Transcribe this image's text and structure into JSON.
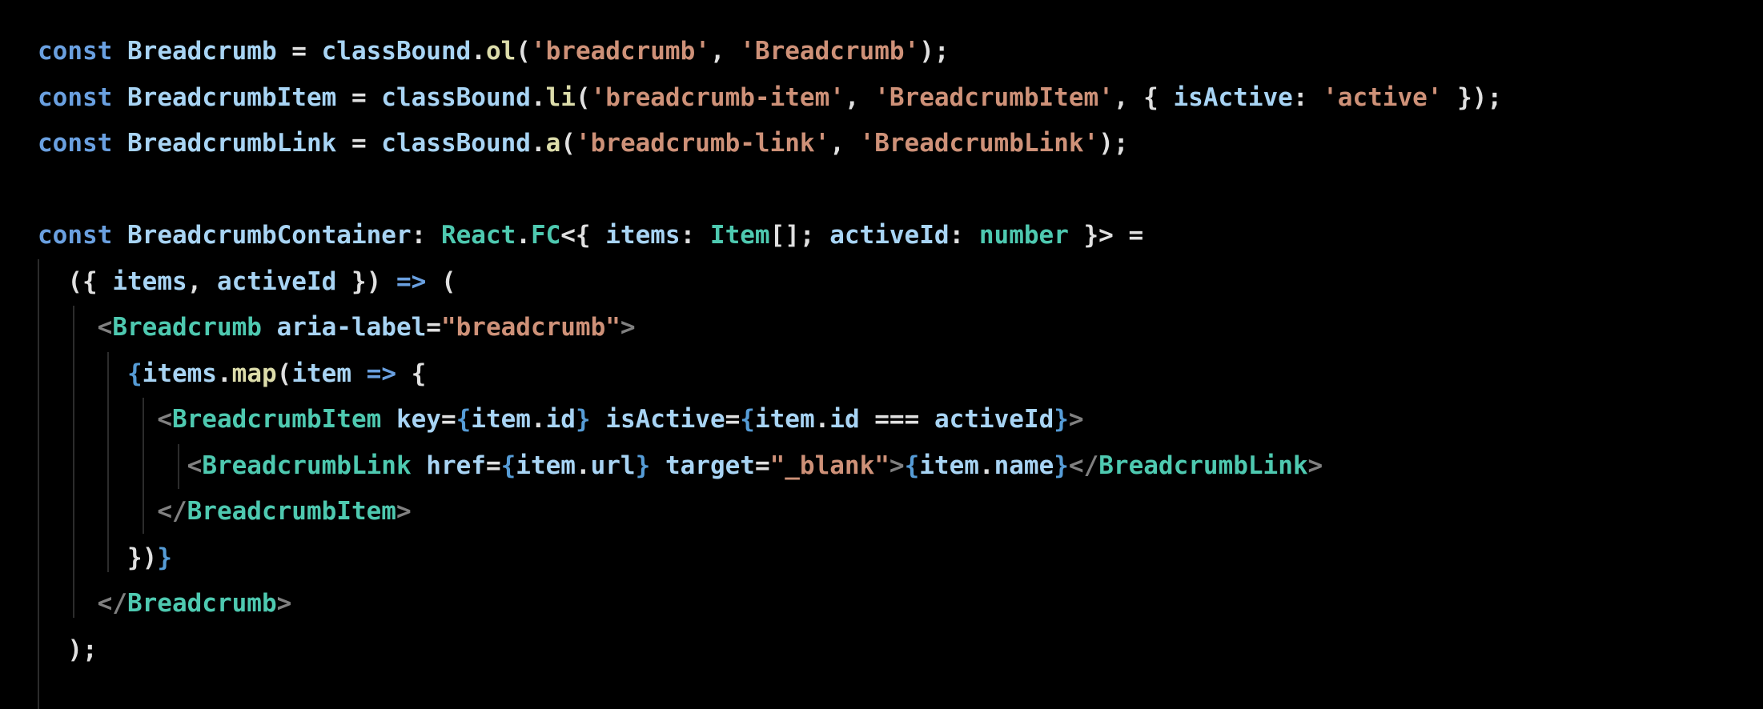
{
  "editor": {
    "lines": [
      [
        {
          "t": "const",
          "c": "kw"
        },
        {
          "t": " ",
          "c": "punc"
        },
        {
          "t": "Breadcrumb",
          "c": "var"
        },
        {
          "t": " = ",
          "c": "punc"
        },
        {
          "t": "classBound",
          "c": "var"
        },
        {
          "t": ".",
          "c": "punc"
        },
        {
          "t": "ol",
          "c": "fn"
        },
        {
          "t": "(",
          "c": "punc"
        },
        {
          "t": "'breadcrumb'",
          "c": "str"
        },
        {
          "t": ", ",
          "c": "punc"
        },
        {
          "t": "'Breadcrumb'",
          "c": "str"
        },
        {
          "t": ");",
          "c": "punc"
        }
      ],
      [
        {
          "t": "const",
          "c": "kw"
        },
        {
          "t": " ",
          "c": "punc"
        },
        {
          "t": "BreadcrumbItem",
          "c": "var"
        },
        {
          "t": " = ",
          "c": "punc"
        },
        {
          "t": "classBound",
          "c": "var"
        },
        {
          "t": ".",
          "c": "punc"
        },
        {
          "t": "li",
          "c": "fn"
        },
        {
          "t": "(",
          "c": "punc"
        },
        {
          "t": "'breadcrumb-item'",
          "c": "str"
        },
        {
          "t": ", ",
          "c": "punc"
        },
        {
          "t": "'BreadcrumbItem'",
          "c": "str"
        },
        {
          "t": ", { ",
          "c": "punc"
        },
        {
          "t": "isActive",
          "c": "var"
        },
        {
          "t": ": ",
          "c": "punc"
        },
        {
          "t": "'active'",
          "c": "str"
        },
        {
          "t": " });",
          "c": "punc"
        }
      ],
      [
        {
          "t": "const",
          "c": "kw"
        },
        {
          "t": " ",
          "c": "punc"
        },
        {
          "t": "BreadcrumbLink",
          "c": "var"
        },
        {
          "t": " = ",
          "c": "punc"
        },
        {
          "t": "classBound",
          "c": "var"
        },
        {
          "t": ".",
          "c": "punc"
        },
        {
          "t": "a",
          "c": "fn"
        },
        {
          "t": "(",
          "c": "punc"
        },
        {
          "t": "'breadcrumb-link'",
          "c": "str"
        },
        {
          "t": ", ",
          "c": "punc"
        },
        {
          "t": "'BreadcrumbLink'",
          "c": "str"
        },
        {
          "t": ");",
          "c": "punc"
        }
      ],
      [],
      [
        {
          "t": "const",
          "c": "kw"
        },
        {
          "t": " ",
          "c": "punc"
        },
        {
          "t": "BreadcrumbContainer",
          "c": "var"
        },
        {
          "t": ": ",
          "c": "punc"
        },
        {
          "t": "React",
          "c": "type"
        },
        {
          "t": ".",
          "c": "punc"
        },
        {
          "t": "FC",
          "c": "type"
        },
        {
          "t": "<{ ",
          "c": "punc"
        },
        {
          "t": "items",
          "c": "var"
        },
        {
          "t": ": ",
          "c": "punc"
        },
        {
          "t": "Item",
          "c": "type"
        },
        {
          "t": "[]; ",
          "c": "punc"
        },
        {
          "t": "activeId",
          "c": "var"
        },
        {
          "t": ": ",
          "c": "punc"
        },
        {
          "t": "number",
          "c": "type"
        },
        {
          "t": " }> =",
          "c": "punc"
        }
      ],
      [
        {
          "t": "  ({ ",
          "c": "punc"
        },
        {
          "t": "items",
          "c": "var"
        },
        {
          "t": ", ",
          "c": "punc"
        },
        {
          "t": "activeId",
          "c": "var"
        },
        {
          "t": " }) ",
          "c": "punc"
        },
        {
          "t": "=>",
          "c": "kw"
        },
        {
          "t": " (",
          "c": "punc"
        }
      ],
      [
        {
          "t": "    ",
          "c": "punc"
        },
        {
          "t": "<",
          "c": "ang"
        },
        {
          "t": "Breadcrumb",
          "c": "tag"
        },
        {
          "t": " ",
          "c": "punc"
        },
        {
          "t": "aria-label",
          "c": "var"
        },
        {
          "t": "=",
          "c": "punc"
        },
        {
          "t": "\"breadcrumb\"",
          "c": "str"
        },
        {
          "t": ">",
          "c": "ang"
        }
      ],
      [
        {
          "t": "      ",
          "c": "punc"
        },
        {
          "t": "{",
          "c": "br"
        },
        {
          "t": "items",
          "c": "var"
        },
        {
          "t": ".",
          "c": "punc"
        },
        {
          "t": "map",
          "c": "fn"
        },
        {
          "t": "(",
          "c": "punc"
        },
        {
          "t": "item",
          "c": "var"
        },
        {
          "t": " ",
          "c": "punc"
        },
        {
          "t": "=>",
          "c": "kw"
        },
        {
          "t": " {",
          "c": "punc"
        }
      ],
      [
        {
          "t": "        ",
          "c": "punc"
        },
        {
          "t": "<",
          "c": "ang"
        },
        {
          "t": "BreadcrumbItem",
          "c": "tag"
        },
        {
          "t": " ",
          "c": "punc"
        },
        {
          "t": "key",
          "c": "var"
        },
        {
          "t": "=",
          "c": "punc"
        },
        {
          "t": "{",
          "c": "br"
        },
        {
          "t": "item",
          "c": "var"
        },
        {
          "t": ".",
          "c": "punc"
        },
        {
          "t": "id",
          "c": "var"
        },
        {
          "t": "}",
          "c": "br"
        },
        {
          "t": " ",
          "c": "punc"
        },
        {
          "t": "isActive",
          "c": "var"
        },
        {
          "t": "=",
          "c": "punc"
        },
        {
          "t": "{",
          "c": "br"
        },
        {
          "t": "item",
          "c": "var"
        },
        {
          "t": ".",
          "c": "punc"
        },
        {
          "t": "id",
          "c": "var"
        },
        {
          "t": " === ",
          "c": "punc"
        },
        {
          "t": "activeId",
          "c": "var"
        },
        {
          "t": "}",
          "c": "br"
        },
        {
          "t": ">",
          "c": "ang"
        }
      ],
      [
        {
          "t": "          ",
          "c": "punc"
        },
        {
          "t": "<",
          "c": "ang"
        },
        {
          "t": "BreadcrumbLink",
          "c": "tag"
        },
        {
          "t": " ",
          "c": "punc"
        },
        {
          "t": "href",
          "c": "var"
        },
        {
          "t": "=",
          "c": "punc"
        },
        {
          "t": "{",
          "c": "br"
        },
        {
          "t": "item",
          "c": "var"
        },
        {
          "t": ".",
          "c": "punc"
        },
        {
          "t": "url",
          "c": "var"
        },
        {
          "t": "}",
          "c": "br"
        },
        {
          "t": " ",
          "c": "punc"
        },
        {
          "t": "target",
          "c": "var"
        },
        {
          "t": "=",
          "c": "punc"
        },
        {
          "t": "\"_blank\"",
          "c": "str"
        },
        {
          "t": ">",
          "c": "ang"
        },
        {
          "t": "{",
          "c": "br"
        },
        {
          "t": "item",
          "c": "var"
        },
        {
          "t": ".",
          "c": "punc"
        },
        {
          "t": "name",
          "c": "var"
        },
        {
          "t": "}",
          "c": "br"
        },
        {
          "t": "</",
          "c": "ang"
        },
        {
          "t": "BreadcrumbLink",
          "c": "tag"
        },
        {
          "t": ">",
          "c": "ang"
        }
      ],
      [
        {
          "t": "        ",
          "c": "punc"
        },
        {
          "t": "</",
          "c": "ang"
        },
        {
          "t": "BreadcrumbItem",
          "c": "tag"
        },
        {
          "t": ">",
          "c": "ang"
        }
      ],
      [
        {
          "t": "      ",
          "c": "punc"
        },
        {
          "t": "})",
          "c": "punc"
        },
        {
          "t": "}",
          "c": "br"
        }
      ],
      [
        {
          "t": "    ",
          "c": "punc"
        },
        {
          "t": "</",
          "c": "ang"
        },
        {
          "t": "Breadcrumb",
          "c": "tag"
        },
        {
          "t": ">",
          "c": "ang"
        }
      ],
      [
        {
          "t": "  );",
          "c": "punc"
        }
      ]
    ]
  }
}
